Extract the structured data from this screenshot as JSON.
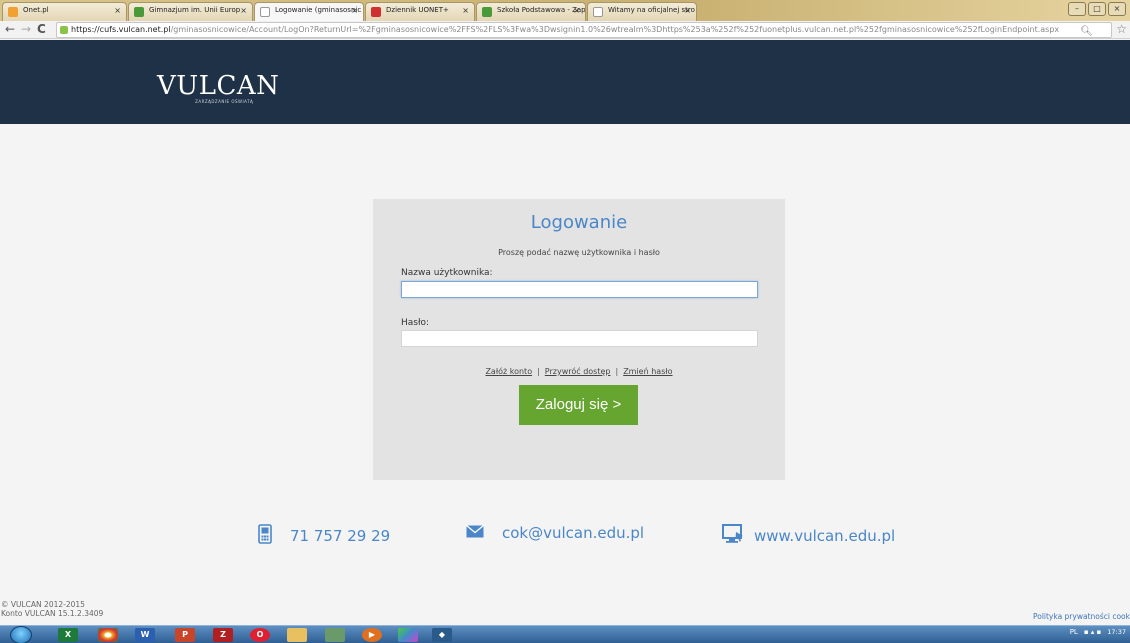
{
  "browser": {
    "tabs": [
      {
        "title": "Onet.pl",
        "favicon_color": "#f0a030"
      },
      {
        "title": "Gimnazjum im. Unii Europ",
        "favicon_color": "#4a9a3a"
      },
      {
        "title": "Logowanie (gminasosnic",
        "favicon_color": "#ffffff"
      },
      {
        "title": "Dziennik UONET+",
        "favicon_color": "#d03030"
      },
      {
        "title": "Szkoła Podstawowa - Zap",
        "favicon_color": "#4a9a3a"
      },
      {
        "title": "Witamy na oficjalnej stro",
        "favicon_color": "#ffffff"
      }
    ],
    "url_host": "https://cufs.vulcan.net.pl",
    "url_path": "/gminasosnicowice/Account/LogOn?ReturnUrl=%2Fgminasosnicowice%2FFS%2FLS%3Fwa%3Dwsignin1.0%26wtrealm%3Dhttps%253a%252f%252fuonetplus.vulcan.net.pl%252fgminasosnicowice%252fLoginEndpoint.aspx"
  },
  "header": {
    "logo_text": "VULCAN",
    "logo_subtitle": "ZARZĄDZANIE OŚWIATĄ"
  },
  "login": {
    "title": "Logowanie",
    "subtitle": "Proszę podać nazwę użytkownika i hasło",
    "username_label": "Nazwa użytkownika:",
    "username_value": "",
    "password_label": "Hasło:",
    "password_value": "",
    "links": [
      "Załóż konto",
      "Przywróć dostęp",
      "Zmień hasło"
    ],
    "submit_label": "Zaloguj się >"
  },
  "contact": {
    "phone": "71 757 29 29",
    "email": "cok@vulcan.edu.pl",
    "website": "www.vulcan.edu.pl"
  },
  "footer": {
    "copyright": "© VULCAN 2012-2015",
    "version": "Konto VULCAN 15.1.2.3409",
    "privacy": "Polityka prywatności cook"
  },
  "taskbar": {
    "lang": "PL",
    "time": "17:37"
  },
  "colors": {
    "header_bg": "#1e3147",
    "accent_blue": "#4a86c8",
    "login_button": "#66a52f"
  }
}
